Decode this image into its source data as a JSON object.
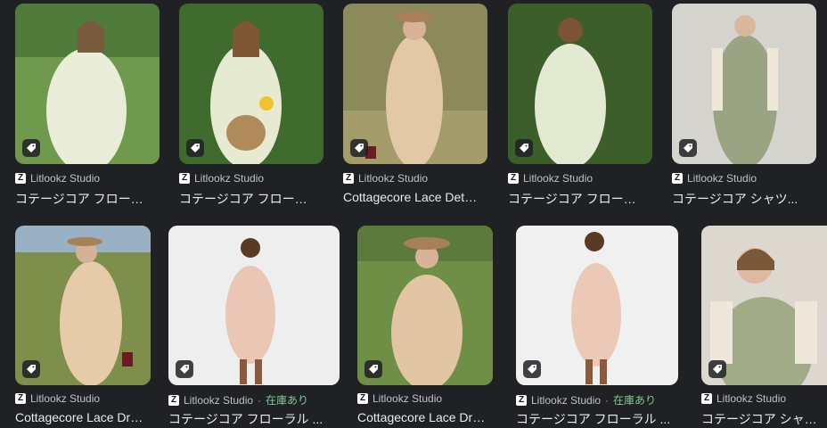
{
  "results": [
    {
      "source": "Litlookz Studio",
      "stock": "",
      "title": "コテージコア フローラル...",
      "bg": "#6f9a4e"
    },
    {
      "source": "Litlookz Studio",
      "stock": "",
      "title": "コテージコア フローラル...",
      "bg": "#3f6b2e"
    },
    {
      "source": "Litlookz Studio",
      "stock": "",
      "title": "Cottagecore Lace Detail...",
      "bg": "#8c8a5a"
    },
    {
      "source": "Litlookz Studio",
      "stock": "",
      "title": "コテージコア フローラル...",
      "bg": "#3b5e2a"
    },
    {
      "source": "Litlookz Studio",
      "stock": "",
      "title": "コテージコア シャツ...",
      "bg": "#d6d4cf"
    },
    {
      "source": "Litlookz Studio",
      "stock": "",
      "title": "Cottagecore Lace Dress...",
      "bg": "#7d8f4a"
    },
    {
      "source": "Litlookz Studio",
      "stock": "在庫あり",
      "title": "コテージコア フローラル ...",
      "bg": "#eeeeee"
    },
    {
      "source": "Litlookz Studio",
      "stock": "",
      "title": "Cottagecore Lace Dress...",
      "bg": "#6e8f45"
    },
    {
      "source": "Litlookz Studio",
      "stock": "在庫あり",
      "title": "コテージコア フローラル ...",
      "bg": "#f0f0f0"
    },
    {
      "source": "Litlookz Studio",
      "stock": "",
      "title": "コテージコア シャツ...",
      "bg": "#dcd8d0"
    }
  ],
  "icons": {
    "favicon_letter": "Z",
    "tag_icon": "price-tag-icon"
  },
  "separator": "·"
}
